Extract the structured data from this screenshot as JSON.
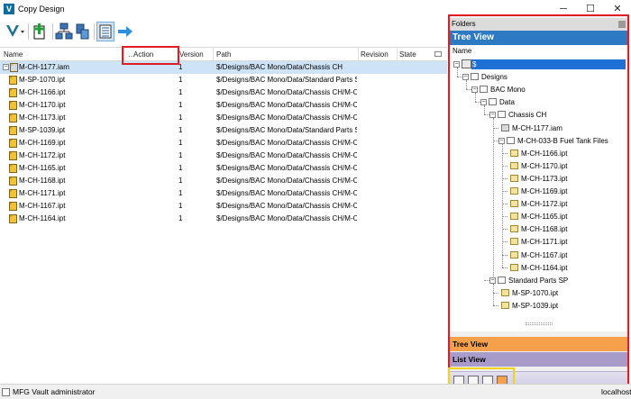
{
  "window": {
    "title": "Copy Design",
    "logo_letter": "V",
    "minimize": "─",
    "maximize": "☐",
    "close": "✕"
  },
  "toolbar": {
    "buttons": [
      "vault-menu-icon",
      "add-icon",
      "tree-icon",
      "copy-icon",
      "grid-icon",
      "next-arrow-icon"
    ]
  },
  "grid": {
    "columns": {
      "name": "Name",
      "action": "Action",
      "version": "Version",
      "path": "Path",
      "revision": "Revision",
      "state": "State"
    },
    "rows": [
      {
        "name": "M-CH-1177.iam",
        "version": "1",
        "path": "$/Designs/BAC Mono/Data/Chassis CH"
      },
      {
        "name": "M-SP-1070.ipt",
        "version": "1",
        "path": "$/Designs/BAC Mono/Data/Standard Parts SP"
      },
      {
        "name": "M-CH-1166.ipt",
        "version": "1",
        "path": "$/Designs/BAC Mono/Data/Chassis CH/M-C..."
      },
      {
        "name": "M-CH-1170.ipt",
        "version": "1",
        "path": "$/Designs/BAC Mono/Data/Chassis CH/M-C..."
      },
      {
        "name": "M-CH-1173.ipt",
        "version": "1",
        "path": "$/Designs/BAC Mono/Data/Chassis CH/M-C..."
      },
      {
        "name": "M-SP-1039.ipt",
        "version": "1",
        "path": "$/Designs/BAC Mono/Data/Standard Parts SP"
      },
      {
        "name": "M-CH-1169.ipt",
        "version": "1",
        "path": "$/Designs/BAC Mono/Data/Chassis CH/M-C..."
      },
      {
        "name": "M-CH-1172.ipt",
        "version": "1",
        "path": "$/Designs/BAC Mono/Data/Chassis CH/M-C..."
      },
      {
        "name": "M-CH-1165.ipt",
        "version": "1",
        "path": "$/Designs/BAC Mono/Data/Chassis CH/M-C..."
      },
      {
        "name": "M-CH-1168.ipt",
        "version": "1",
        "path": "$/Designs/BAC Mono/Data/Chassis CH/M-C..."
      },
      {
        "name": "M-CH-1171.ipt",
        "version": "1",
        "path": "$/Designs/BAC Mono/Data/Chassis CH/M-C..."
      },
      {
        "name": "M-CH-1167.ipt",
        "version": "1",
        "path": "$/Designs/BAC Mono/Data/Chassis CH/M-C..."
      },
      {
        "name": "M-CH-1164.ipt",
        "version": "1",
        "path": "$/Designs/BAC Mono/Data/Chassis CH/M-C..."
      }
    ]
  },
  "folders": {
    "header": "Folders",
    "tree_view_title": "Tree View",
    "name_header": "Name",
    "nodes": [
      {
        "label": "$"
      },
      {
        "label": "Designs"
      },
      {
        "label": "BAC Mono"
      },
      {
        "label": "Data"
      },
      {
        "label": "Chassis CH"
      },
      {
        "label": "M-CH-1177.iam"
      },
      {
        "label": "M-CH-033-B Fuel Tank Files"
      },
      {
        "label": "M-CH-1166.ipt"
      },
      {
        "label": "M-CH-1170.ipt"
      },
      {
        "label": "M-CH-1173.ipt"
      },
      {
        "label": "M-CH-1169.ipt"
      },
      {
        "label": "M-CH-1172.ipt"
      },
      {
        "label": "M-CH-1165.ipt"
      },
      {
        "label": "M-CH-1168.ipt"
      },
      {
        "label": "M-CH-1171.ipt"
      },
      {
        "label": "M-CH-1167.ipt"
      },
      {
        "label": "M-CH-1164.ipt"
      },
      {
        "label": "Standard Parts SP"
      },
      {
        "label": "M-SP-1070.ipt"
      },
      {
        "label": "M-SP-1039.ipt"
      }
    ],
    "tab_tree_view": "Tree View",
    "tab_list_view": "List View"
  },
  "status": {
    "user": "MFG Vault administrator",
    "server": "localhost"
  },
  "colors": {
    "accent_blue": "#2e7ac2",
    "tab_orange": "#f5a04a",
    "tab_purple": "#a79cc9",
    "highlight_red": "#e01c24",
    "highlight_yellow": "#f1d51a",
    "selected_row": "#cfe3f7"
  }
}
